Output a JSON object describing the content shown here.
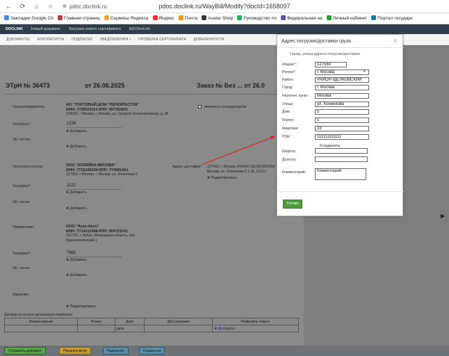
{
  "browser": {
    "url": "pdoc.doclink.ru/WayBill/Modify?docId=1658097",
    "tab_url": "pdoc.doclink.ru",
    "lock": "⊕"
  },
  "bookmarks": [
    {
      "label": "Закладки Google Ch",
      "color": "#4285f4"
    },
    {
      "label": "Главная страниц",
      "color": "#c33"
    },
    {
      "label": "Сервисы Яндекса",
      "color": "#ea4"
    },
    {
      "label": "Яндекс",
      "color": "#e33"
    },
    {
      "label": "Почта",
      "color": "#f90"
    },
    {
      "label": "Avatar Shop",
      "color": "#333"
    },
    {
      "label": "Руководство по",
      "color": "#1b5"
    },
    {
      "label": "Федеральная на",
      "color": "#559"
    },
    {
      "label": "Личный кабинет",
      "color": "#393"
    },
    {
      "label": "Портал государс",
      "color": "#27a"
    }
  ],
  "appnav": {
    "logo": "DOCLINK",
    "items": [
      "Новый документ",
      "Загрузка нового сертификата",
      "EDI.DocLink"
    ]
  },
  "tabs": [
    "ДОКУМЕНТЫ",
    "КОНТРАГЕНТЫ",
    "ПОДПИСКИ",
    "УВЕДОМЛЕНИЯ ⁸",
    "ПРОВЕРКА СЕРТИФИКАТА",
    "ДОВЕРЕННОСТИ"
  ],
  "doc": {
    "title_left": "ЭТрН № 36473",
    "title_date": "от 26.06.2025",
    "title_right": "Заказ № Без ... от 26.0",
    "consignor_label": "Грузоотправитель:",
    "consignor_name": "АО \"ТОРГОВЫЙ ДОМ \"ПЕРЕКРЕСТОК\"",
    "consignor_inn": "ИНН: 7728029110 КПП: 997350001",
    "consignor_addr": "109029, г Москва, г. Москва, ул. Средняя Калитниковская, д. 28",
    "forwarder_label": "является экспедитором",
    "phone_label": "Телефон*:",
    "phone1": "1234",
    "email_label": "Эл. почта:",
    "add_label": "Добавить",
    "consignee_label": "Грузополучатель:",
    "consignee_name": "ООО \"КОПЕЙКА-МОСКВА\"",
    "consignee_inn": "ИНН: 7715196234 КПП: 774661001",
    "consignee_addr": "127560, г Москва, г. Москва, ул. Коненкова 5",
    "delivery_label": "Адрес доставки*:",
    "delivery_addr1": "127560, г. Москва, РАЙОН ЩЕЛКОВСКИЙ",
    "delivery_addr2": "Москва, ул. Коненкова 5 1 33, 111111",
    "edit_label": "Редактировать",
    "phone2": "1122",
    "carrier_label": "Перевозчик:",
    "carrier_name": "ООО \"Агро-Авто\"",
    "carrier_inn": "ИНН: 7714211088 КПП: 504701001",
    "carrier_addr1": "141733, г. Лобня, Московская область, пер.",
    "carrier_addr2": "Краснополянский 1",
    "phone3": "7881",
    "customer_label": "Заказчик:",
    "contract_label": "Договор на услуги организации перевозки",
    "table_headers": [
      "Наименование",
      "Номер",
      "Дата",
      "Доп.сведения",
      "Реквизиты сторон"
    ],
    "table_date": "дата"
  },
  "footer": [
    "Сохранить документ",
    "Предпросмотр",
    "Подписать",
    "Создать из"
  ],
  "modal": {
    "title": "Адрес погрузки/доставки груза",
    "close": "x",
    "subtitle": "Город, улица адреса погрузки/доставки",
    "fields": [
      {
        "label": "Индекс*:",
        "value": "127560"
      },
      {
        "label": "Регион*:",
        "value": "г. Москва"
      },
      {
        "label": "Район:",
        "value": "РАЙОН ЩЕЛКОВСКИЙ"
      },
      {
        "label": "Город:",
        "value": "г. Москва"
      },
      {
        "label": "Населен. пункт:",
        "value": "Москва"
      },
      {
        "label": "Улица:",
        "value": "ул. Коненкова"
      },
      {
        "label": "Дом:",
        "value": "5"
      },
      {
        "label": "Корпус:",
        "value": "1"
      },
      {
        "label": "Квартира:",
        "value": "33"
      },
      {
        "label": "ПЗН:",
        "value": "111111111111"
      }
    ],
    "coords_label": "Координаты",
    "lat_label": "Широта:",
    "lat": "",
    "lon_label": "Долгота:",
    "lon": "",
    "comment_label": "Комментарий:",
    "comment": "Комментарий:",
    "ok": "Готово"
  }
}
